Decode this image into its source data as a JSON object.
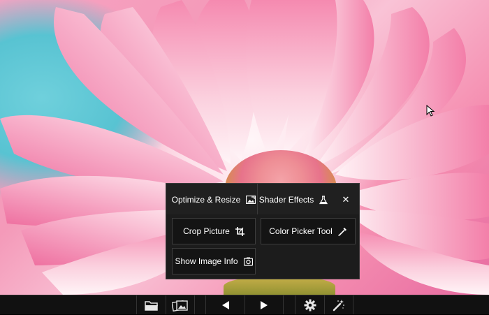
{
  "background": {
    "subject": "pink-daisy-photo"
  },
  "menu": {
    "optimize_label": "Optimize & Resize",
    "optimize_icon": "image-resize-icon",
    "shader_label": "Shader Effects",
    "shader_icon": "flask-icon",
    "close_glyph": "✕",
    "crop_label": "Crop Picture",
    "crop_icon": "crop-icon",
    "color_picker_label": "Color Picker Tool",
    "color_picker_icon": "eyedropper-icon",
    "info_label": "Show Image Info",
    "info_icon": "camera-info-icon"
  },
  "toolbar": {
    "items": [
      {
        "name": "open-folder",
        "icon": "folder-icon"
      },
      {
        "name": "gallery",
        "icon": "images-icon"
      },
      {
        "name": "previous",
        "icon": "arrow-left-icon"
      },
      {
        "name": "next",
        "icon": "arrow-right-icon"
      },
      {
        "name": "settings",
        "icon": "gear-icon"
      },
      {
        "name": "effects",
        "icon": "magic-wand-icon"
      }
    ]
  },
  "colors": {
    "menu_bg": "#1c1c1c",
    "toolbar_bg": "#111111",
    "text": "#ffffff",
    "petal_pink": "#f49ab9",
    "sky_blue": "#58c3d2"
  }
}
